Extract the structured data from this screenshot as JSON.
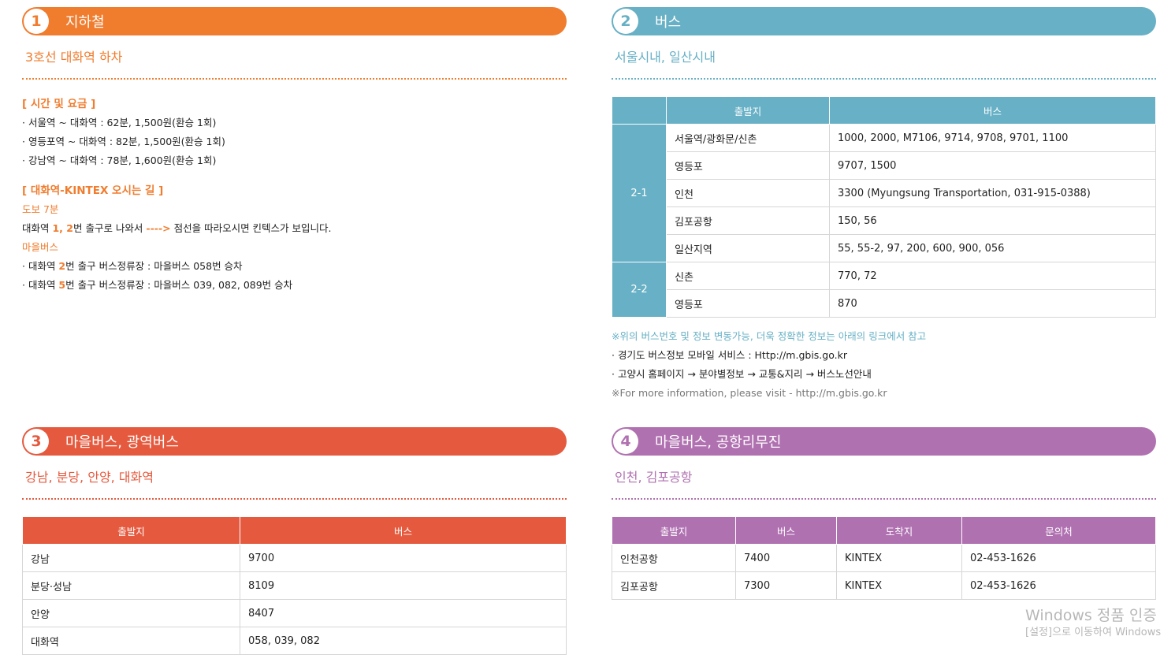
{
  "colors": {
    "section1": "#f07c2e",
    "section2": "#67b0c5",
    "section3": "#e55a3e",
    "section4": "#b071b1"
  },
  "section1": {
    "number": "1",
    "title": "지하철",
    "subtitle": "3호선 대화역 하차",
    "time_heading": "[ 시간 및 요금 ]",
    "time_lines": [
      "· 서울역 ~ 대화역 : 62분, 1,500원(환승 1회)",
      "· 영등포역 ~ 대화역 : 82분, 1,500원(환승 1회)",
      "· 강남역 ~ 대화역 : 78분, 1,600원(환승 1회)"
    ],
    "route_heading": "[ 대화역-KINTEX 오시는 길 ]",
    "walk_label": "도보 7분",
    "walk_text_prefix": "대화역 ",
    "walk_exits": "1, 2",
    "walk_text_mid": "번 출구로 나와서 ",
    "walk_arrow": "---->",
    "walk_text_suffix": " 점선을 따라오시면 킨텍스가 보입니다.",
    "village_bus_label": "마을버스",
    "village_line1_prefix": "· 대화역 ",
    "village_line1_exit": "2",
    "village_line1_suffix": "번 출구 버스정류장 : 마을버스 058번 승차",
    "village_line2_prefix": "· 대화역 ",
    "village_line2_exit": "5",
    "village_line2_suffix": "번 출구 버스정류장 : 마을버스 039, 082, 089번 승차"
  },
  "section2": {
    "number": "2",
    "title": "버스",
    "subtitle": "서울시내, 일산시내",
    "table_headers": [
      "",
      "출발지",
      "버스"
    ],
    "groups": [
      {
        "label": "2-1",
        "rows": [
          {
            "origin": "서울역/광화문/신촌",
            "bus": "1000, 2000, M7106, 9714, 9708, 9701, 1100"
          },
          {
            "origin": "영등포",
            "bus": "9707, 1500"
          },
          {
            "origin": "인천",
            "bus": "3300 (Myungsung Transportation, 031-915-0388)"
          },
          {
            "origin": "김포공항",
            "bus": "150, 56"
          },
          {
            "origin": "일산지역",
            "bus": "55, 55-2, 97, 200, 600, 900, 056"
          }
        ]
      },
      {
        "label": "2-2",
        "rows": [
          {
            "origin": "신촌",
            "bus": "770, 72"
          },
          {
            "origin": "영등포",
            "bus": "870"
          }
        ]
      }
    ],
    "note_warning": "※위의 버스번호 및 정보 변동가능, 더욱 정확한 정보는 아래의 링크에서 참고",
    "note_line1": "· 경기도 버스정보 모바일 서비스 : Http://m.gbis.go.kr",
    "note_line2": "· 고양시 홈페이지 → 분야별정보 → 교통&지리 → 버스노선안내",
    "note_english": "※For more information, please visit - http://m.gbis.go.kr"
  },
  "section3": {
    "number": "3",
    "title": "마을버스, 광역버스",
    "subtitle": "강남, 분당, 안양, 대화역",
    "table_headers": [
      "출발지",
      "버스"
    ],
    "rows": [
      {
        "origin": "강남",
        "bus": "9700"
      },
      {
        "origin": "분당·성남",
        "bus": "8109"
      },
      {
        "origin": "안양",
        "bus": "8407"
      },
      {
        "origin": "대화역",
        "bus": "058, 039, 082"
      }
    ]
  },
  "section4": {
    "number": "4",
    "title": "마을버스, 공항리무진",
    "subtitle": "인천, 김포공항",
    "table_headers": [
      "출발지",
      "버스",
      "도착지",
      "문의처"
    ],
    "rows": [
      {
        "origin": "인천공항",
        "bus": "7400",
        "destination": "KINTEX",
        "contact": "02-453-1626"
      },
      {
        "origin": "김포공항",
        "bus": "7300",
        "destination": "KINTEX",
        "contact": "02-453-1626"
      }
    ]
  },
  "watermark": {
    "line1": "Windows 정품 인증",
    "line2": "[설정]으로 이동하여 Windows"
  }
}
